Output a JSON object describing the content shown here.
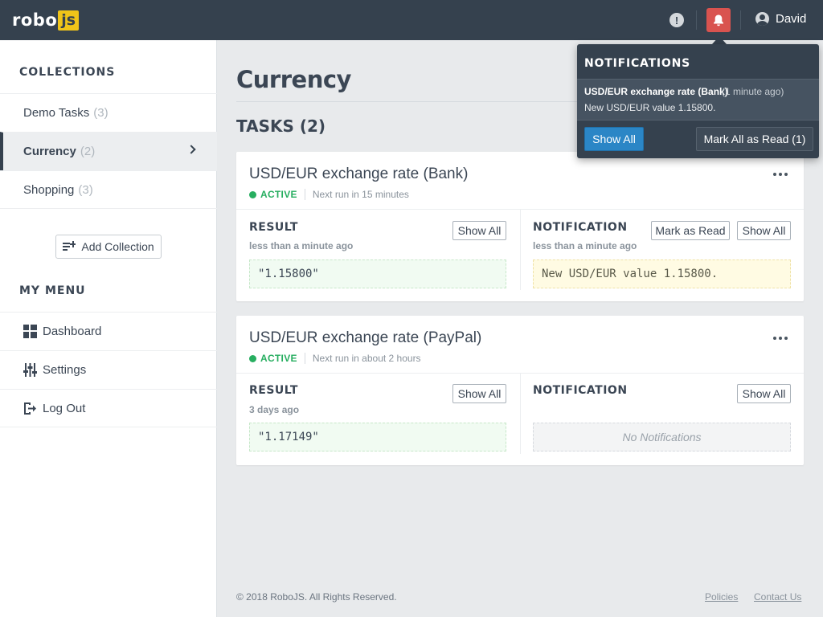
{
  "app": {
    "logo_text": "robo",
    "logo_badge": "js",
    "user_name": "David",
    "colors": {
      "topbar": "#35414e",
      "accent_yellow": "#f0c419",
      "bell_active": "#d9534f",
      "status_active": "#27ae60",
      "primary_button": "#2b86c6"
    }
  },
  "header": {
    "alert_icon": "exclamation-circle-icon",
    "bell_icon": "bell-icon",
    "user_icon": "user-circle-icon"
  },
  "sidebar": {
    "collections_heading": "COLLECTIONS",
    "collections": [
      {
        "label": "Demo Tasks",
        "count": "(3)"
      },
      {
        "label": "Currency",
        "count": "(2)",
        "active": true
      },
      {
        "label": "Shopping",
        "count": "(3)"
      }
    ],
    "add_collection_label": "Add Collection",
    "menu_heading": "MY MENU",
    "menu": [
      {
        "label": "Dashboard",
        "icon": "grid-icon"
      },
      {
        "label": "Settings",
        "icon": "sliders-icon"
      },
      {
        "label": "Log Out",
        "icon": "logout-icon"
      }
    ]
  },
  "main": {
    "page_title": "Currency",
    "tasks_heading": "TASKS (2)",
    "tasks": [
      {
        "title": "USD/EUR exchange rate (Bank)",
        "status": "ACTIVE",
        "next_run": "Next run in 15 minutes",
        "result_label": "RESULT",
        "result_time": "less than a minute ago",
        "result_value": "\"1.15800\"",
        "result_show_all": "Show All",
        "notification_label": "NOTIFICATION",
        "notification_time": "less than a minute ago",
        "notification_value": "New USD/EUR value 1.15800.",
        "notification_mark_read": "Mark as Read",
        "notification_show_all": "Show All"
      },
      {
        "title": "USD/EUR exchange rate (PayPal)",
        "status": "ACTIVE",
        "next_run": "Next run in about 2 hours",
        "result_label": "RESULT",
        "result_time": "3 days ago",
        "result_value": "\"1.17149\"",
        "result_show_all": "Show All",
        "notification_label": "NOTIFICATION",
        "notification_empty": "No Notifications",
        "notification_show_all": "Show All"
      }
    ]
  },
  "footer": {
    "copyright": "© 2018 RoboJS. All Rights Reserved.",
    "links": [
      "Policies",
      "Contact Us"
    ]
  },
  "notifications_popover": {
    "title": "NOTIFICATIONS",
    "items": [
      {
        "title": "USD/EUR exchange rate (Bank)",
        "time": "(1 minute ago)",
        "body": "New USD/EUR value 1.15800."
      }
    ],
    "show_all_label": "Show All",
    "mark_all_read_label": "Mark All as Read (1)"
  }
}
